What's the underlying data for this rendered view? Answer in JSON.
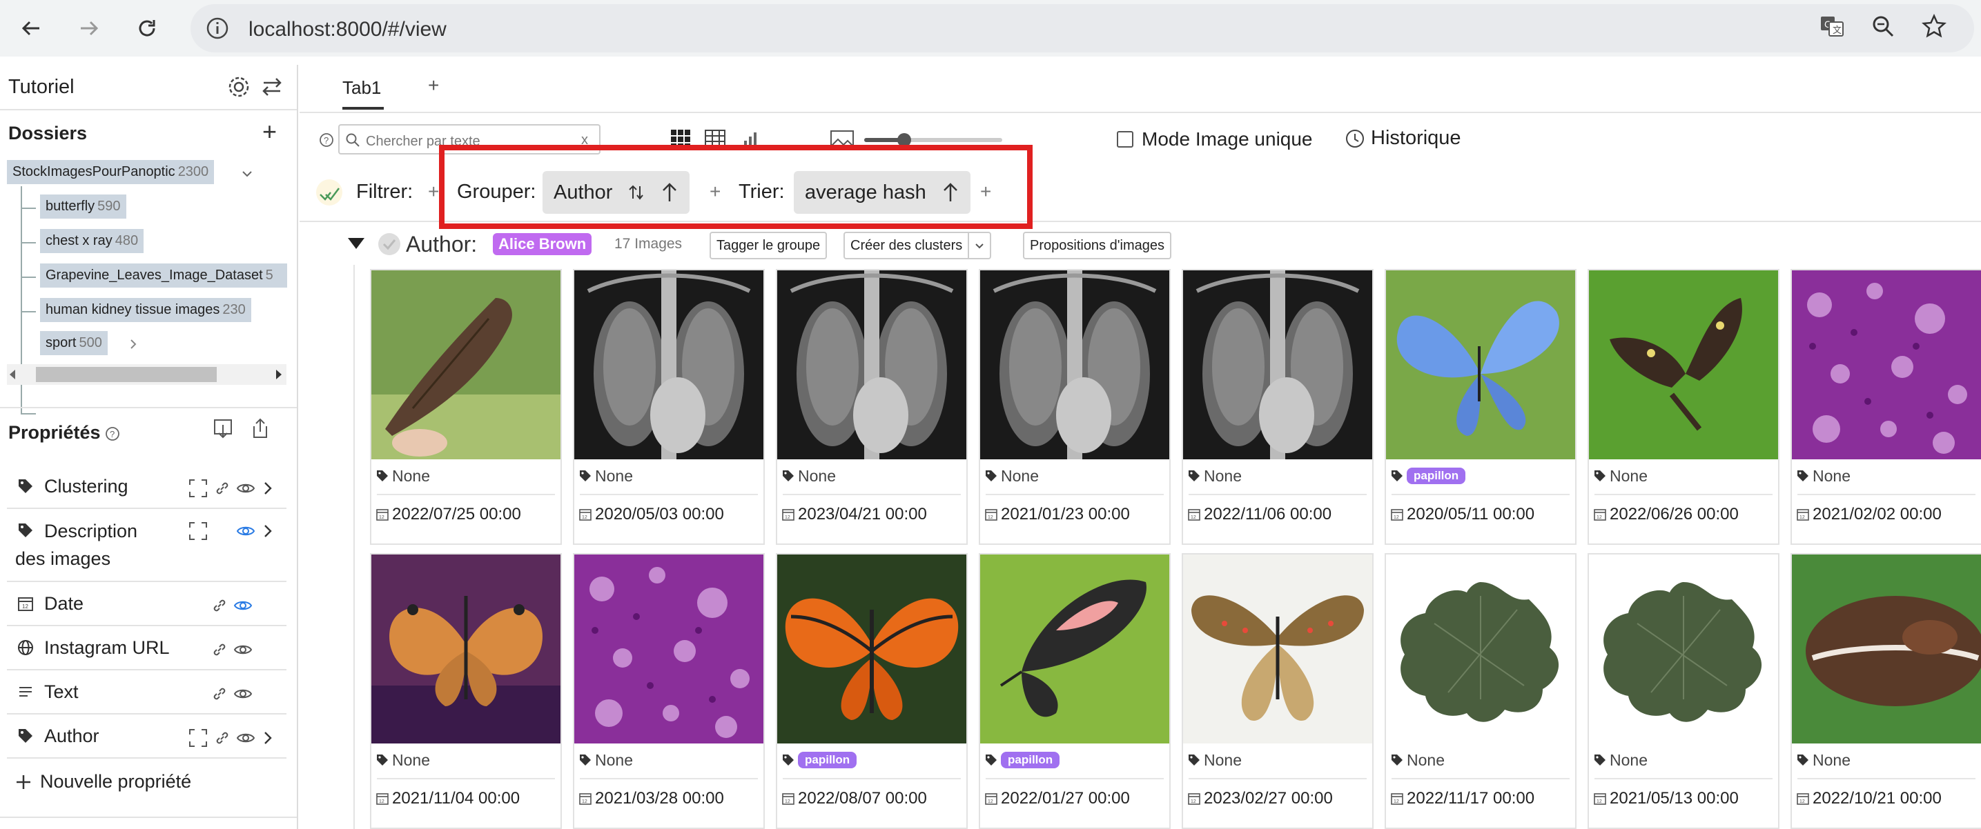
{
  "browser": {
    "url": "localhost:8000/#/view"
  },
  "sidebar": {
    "title": "Tutoriel",
    "folders_header": "Dossiers",
    "root_folder": {
      "name": "StockImagesPourPanoptic",
      "count": "2300"
    },
    "subfolders": [
      {
        "name": "butterfly",
        "count": "590"
      },
      {
        "name": "chest x ray",
        "count": "480"
      },
      {
        "name": "Grapevine_Leaves_Image_Dataset",
        "count": "5"
      },
      {
        "name": "human kidney tissue images",
        "count": "230"
      },
      {
        "name": "sport",
        "count": "500"
      }
    ],
    "properties_header": "Propriétés",
    "properties": [
      {
        "label": "Clustering",
        "icon": "tag-icon"
      },
      {
        "label": "Description des images",
        "icon": "tag-icon"
      },
      {
        "label": "Date",
        "icon": "calendar-icon"
      },
      {
        "label": "Instagram URL",
        "icon": "globe-icon"
      },
      {
        "label": "Text",
        "icon": "text-icon"
      },
      {
        "label": "Author",
        "icon": "tag-icon"
      }
    ],
    "new_property": "Nouvelle propriété"
  },
  "tabs": [
    {
      "label": "Tab1"
    }
  ],
  "tab_add": "+",
  "toolbar": {
    "search_placeholder": "Chercher par texte",
    "search_clear": "x",
    "single_image_mode": "Mode Image unique",
    "history": "Historique",
    "filter_label": "Filtrer:",
    "group_label": "Grouper:",
    "group_value": "Author",
    "sort_label": "Trier:",
    "sort_value": "average hash",
    "plus": "+"
  },
  "group": {
    "property": "Author:",
    "value": "Alice Brown",
    "count": "17 Images",
    "tag_button": "Tagger le groupe",
    "cluster_button": "Créer des clusters",
    "suggest_button": "Propositions d'images"
  },
  "images": [
    {
      "tag": "None",
      "date": "2022/07/25 00:00",
      "kind": "butterfly-brown"
    },
    {
      "tag": "None",
      "date": "2020/05/03 00:00",
      "kind": "xray"
    },
    {
      "tag": "None",
      "date": "2023/04/21 00:00",
      "kind": "xray"
    },
    {
      "tag": "None",
      "date": "2021/01/23 00:00",
      "kind": "xray"
    },
    {
      "tag": "None",
      "date": "2022/11/06 00:00",
      "kind": "xray"
    },
    {
      "tag": "papillon",
      "date": "2020/05/11 00:00",
      "kind": "butterfly-blue"
    },
    {
      "tag": "None",
      "date": "2022/06/26 00:00",
      "kind": "butterfly-dark"
    },
    {
      "tag": "None",
      "date": "2021/02/02 00:00",
      "kind": "tissue"
    },
    {
      "tag": "None",
      "date": "2021/11/04 00:00",
      "kind": "butterfly-orange"
    },
    {
      "tag": "None",
      "date": "2021/03/28 00:00",
      "kind": "tissue"
    },
    {
      "tag": "papillon",
      "date": "2022/08/07 00:00",
      "kind": "butterfly-monarch"
    },
    {
      "tag": "papillon",
      "date": "2022/01/27 00:00",
      "kind": "butterfly-red"
    },
    {
      "tag": "None",
      "date": "2023/02/27 00:00",
      "kind": "butterfly-tan"
    },
    {
      "tag": "None",
      "date": "2022/11/17 00:00",
      "kind": "leaf"
    },
    {
      "tag": "None",
      "date": "2021/05/13 00:00",
      "kind": "leaf"
    },
    {
      "tag": "None",
      "date": "2022/10/21 00:00",
      "kind": "butterfly-brown2"
    }
  ],
  "colors": {
    "accent_tag": "#a070f0",
    "highlight_box": "#e02020",
    "folder_chip": "#ccd6e0"
  }
}
